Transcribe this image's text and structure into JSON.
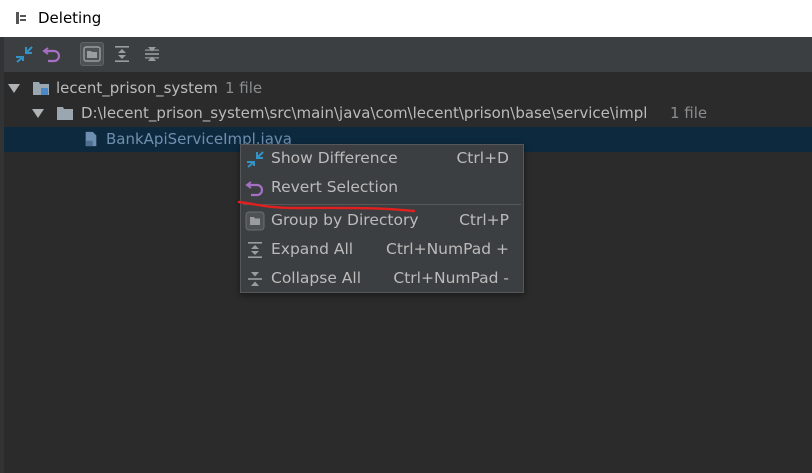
{
  "window": {
    "title": "Deleting"
  },
  "toolbar": {
    "buttons": [
      {
        "icon": "show-diff-arrows-icon"
      },
      {
        "icon": "revert-arrow-icon"
      },
      {
        "icon": "group-by-directory-icon",
        "active": true
      },
      {
        "icon": "expand-all-icon"
      },
      {
        "icon": "collapse-all-icon"
      }
    ]
  },
  "tree": {
    "root": {
      "label": "lecent_prison_system",
      "count": "1 file"
    },
    "directory": {
      "label": "D:\\lecent_prison_system\\src\\main\\java\\com\\lecent\\prison\\base\\service\\impl",
      "count": "1 file"
    },
    "file": {
      "label": "BankApiServiceImpl.java"
    }
  },
  "context_menu": {
    "items": [
      {
        "label": "Show Difference",
        "shortcut": "Ctrl+D",
        "icon": "show-diff-arrows-icon"
      },
      {
        "label": "Revert Selection",
        "shortcut": "",
        "icon": "revert-arrow-icon"
      },
      {
        "label": "Group by Directory",
        "shortcut": "Ctrl+P",
        "icon": "group-by-directory-icon"
      },
      {
        "label": "Expand All",
        "shortcut": "Ctrl+NumPad +",
        "icon": "expand-all-icon"
      },
      {
        "label": "Collapse All",
        "shortcut": "Ctrl+NumPad -",
        "icon": "collapse-all-icon"
      }
    ]
  },
  "colors": {
    "background": "#2b2b2b",
    "toolbar": "#3c3f41",
    "selection": "#0d293e",
    "annotation": "#e0201f",
    "diff_icon": "#3592c4",
    "revert_icon": "#a46fc4"
  }
}
